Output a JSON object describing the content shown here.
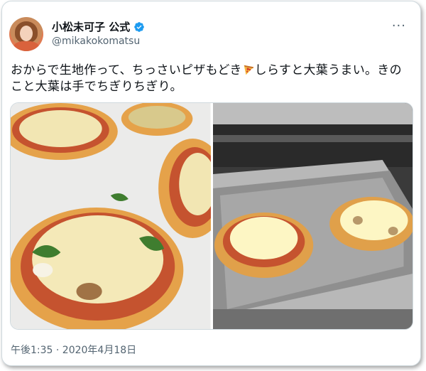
{
  "tweet": {
    "display_name": "小松未可子 公式",
    "handle": "@mikakokomatsu",
    "text_before_emoji": "おからで生地作って、ちっさいピザもどき",
    "text_after_emoji": "しらすと大葉うまい。きのこと大葉は手でちぎりちぎり。",
    "emoji": "pizza-emoji",
    "timestamp": "午後1:35 · 2020年4月18日",
    "more_label": "···",
    "verified_color": "#1d9bf0"
  },
  "media": {
    "photo_left": "pizza-tray-photo",
    "photo_right": "toaster-oven-photo"
  }
}
